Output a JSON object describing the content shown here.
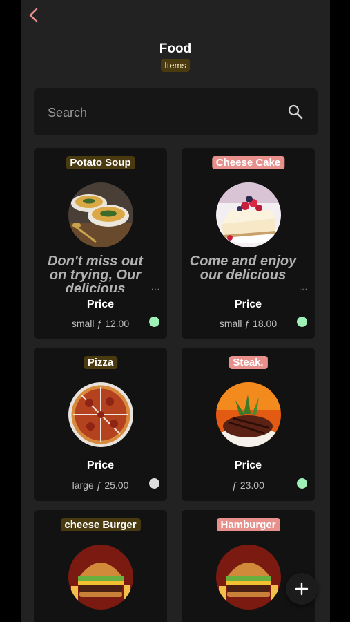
{
  "header": {
    "title": "Food",
    "subtitle": "Items"
  },
  "search": {
    "placeholder": "Search"
  },
  "items": [
    {
      "name": "Potato Soup",
      "description": "Don't miss out on trying, Our delicious",
      "more": "...",
      "price_label": "Price",
      "price": "small ƒ 12.00",
      "status": "green"
    },
    {
      "name": "Cheese Cake",
      "description": "Come and enjoy our delicious",
      "more": "...",
      "price_label": "Price",
      "price": "small ƒ 18.00",
      "status": "green"
    },
    {
      "name": "Pizza",
      "price_label": "Price",
      "price": "large ƒ 25.00",
      "status": "gray"
    },
    {
      "name": "Steak.",
      "price_label": "Price",
      "price": "ƒ 23.00",
      "status": "green"
    },
    {
      "name": "cheese Burger"
    },
    {
      "name": "Hamburger"
    }
  ],
  "colors": {
    "accent": "#e8908c",
    "gold_badge": "#4a3a10",
    "available": "#9ef0b8",
    "unavailable": "#dddddd"
  },
  "icons": {
    "back": "chevron-left-icon",
    "search": "search-icon",
    "add": "plus-icon"
  }
}
